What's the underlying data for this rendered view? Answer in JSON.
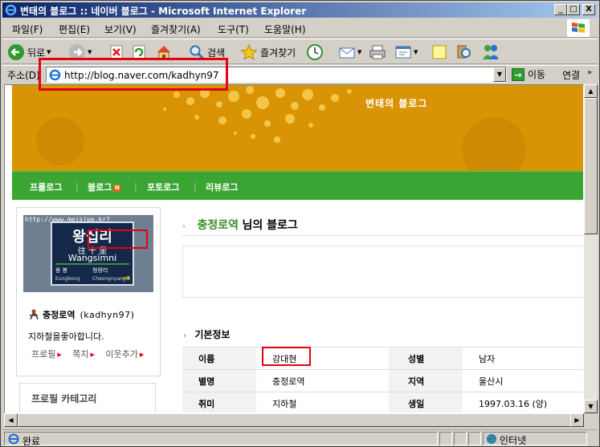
{
  "window": {
    "title": "변태의 블로그 :: 네이버 블로그 - Microsoft Internet Explorer",
    "minimize": "_",
    "maximize": "□",
    "close": "X"
  },
  "menu": [
    "파일(F)",
    "편집(E)",
    "보기(V)",
    "즐겨찾기(A)",
    "도구(T)",
    "도움말(H)"
  ],
  "toolbar": {
    "back_label": "뒤로",
    "search_label": "검색",
    "favorites_label": "즐겨찾기"
  },
  "address": {
    "label": "주소(D)",
    "url": "http://blog.naver.com/kadhyn97",
    "go_label": "이동",
    "links_label": "연결"
  },
  "blog": {
    "banner_title": "변태의 블로그",
    "nav": [
      "프롤로그",
      "블로그",
      "포토로그",
      "리뷰로그"
    ],
    "new_badge": "N",
    "profile": {
      "photo_url": "http://www.meisjpe.kr?",
      "sign_main": "왕십리",
      "sign_hanja": "往 十 里",
      "sign_roman": "Wangsimni",
      "sign_left": "용  봉",
      "sign_right": "청량리",
      "sign_left2": "Eungbong",
      "sign_right2": "Cheongnyangni",
      "nickname": "충정로역",
      "user_id": "(kadhyn97)",
      "status": "지하철을좋아합니다.",
      "links": [
        "프로필",
        "쪽지",
        "이웃추가"
      ]
    },
    "category_title": "프로필 카테고리",
    "main_title_nick": "충정로역",
    "main_title_suffix": "님의 블로그",
    "info_header": "기본정보",
    "info": [
      {
        "k1": "이름",
        "v1": "강대현",
        "k2": "성별",
        "v2": "남자"
      },
      {
        "k1": "별명",
        "v1": "충정로역",
        "k2": "지역",
        "v2": "울산시"
      },
      {
        "k1": "취미",
        "v1": "지하철",
        "k2": "생일",
        "v2": "1997.03.16 (양)"
      }
    ]
  },
  "status": {
    "text": "완료",
    "zone": "인터넷"
  }
}
